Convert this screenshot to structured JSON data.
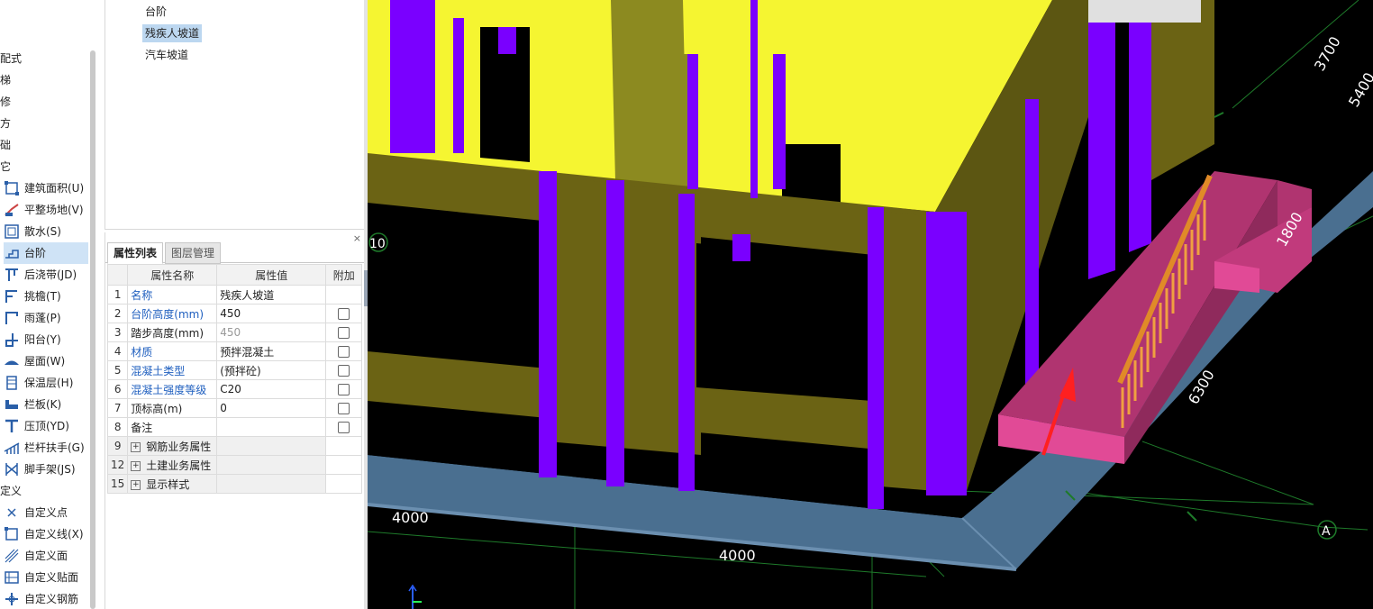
{
  "nav": {
    "groups": [
      {
        "label": "配式"
      },
      {
        "label": "梯"
      },
      {
        "label": "修"
      },
      {
        "label": "方"
      },
      {
        "label": "础"
      },
      {
        "label": "它"
      }
    ],
    "items": [
      {
        "label": "建筑面积(U)",
        "icon": "area-icon"
      },
      {
        "label": "平整场地(V)",
        "icon": "level-site-icon"
      },
      {
        "label": "散水(S)",
        "icon": "apron-icon"
      },
      {
        "label": "台阶",
        "icon": "step-icon"
      },
      {
        "label": "后浇带(JD)",
        "icon": "post-pour-strip-icon"
      },
      {
        "label": "挑檐(T)",
        "icon": "eave-icon"
      },
      {
        "label": "雨蓬(P)",
        "icon": "canopy-icon"
      },
      {
        "label": "阳台(Y)",
        "icon": "balcony-icon"
      },
      {
        "label": "屋面(W)",
        "icon": "roof-icon"
      },
      {
        "label": "保温层(H)",
        "icon": "insulation-icon"
      },
      {
        "label": "栏板(K)",
        "icon": "parapet-icon"
      },
      {
        "label": "压顶(YD)",
        "icon": "coping-icon"
      },
      {
        "label": "栏杆扶手(G)",
        "icon": "railing-icon"
      },
      {
        "label": "脚手架(JS)",
        "icon": "scaffold-icon"
      }
    ],
    "group2": {
      "label": "定义"
    },
    "items2": [
      {
        "label": "自定义点",
        "icon": "custom-point-icon"
      },
      {
        "label": "自定义线(X)",
        "icon": "custom-line-icon"
      },
      {
        "label": "自定义面",
        "icon": "custom-face-icon"
      },
      {
        "label": "自定义贴面",
        "icon": "custom-veneer-icon"
      },
      {
        "label": "自定义钢筋",
        "icon": "custom-rebar-icon"
      }
    ]
  },
  "typelist": {
    "items": [
      {
        "label": "台阶"
      },
      {
        "label": "残疾人坡道"
      },
      {
        "label": "汽车坡道"
      }
    ]
  },
  "props": {
    "close": "×",
    "tabs": [
      {
        "label": "属性列表"
      },
      {
        "label": "图层管理"
      }
    ],
    "headers": {
      "name": "属性名称",
      "value": "属性值",
      "extra": "附加"
    },
    "rows": [
      {
        "num": "1",
        "name": "名称",
        "value": "残疾人坡道"
      },
      {
        "num": "2",
        "name": "台阶高度(mm)",
        "value": "450"
      },
      {
        "num": "3",
        "name": "踏步高度(mm)",
        "value": "450"
      },
      {
        "num": "4",
        "name": "材质",
        "value": "预拌混凝土"
      },
      {
        "num": "5",
        "name": "混凝土类型",
        "value": "(预拌砼)"
      },
      {
        "num": "6",
        "name": "混凝土强度等级",
        "value": "C20"
      },
      {
        "num": "7",
        "name": "顶标高(m)",
        "value": "0"
      },
      {
        "num": "8",
        "name": "备注",
        "value": ""
      },
      {
        "num": "9",
        "name": "钢筋业务属性",
        "value": ""
      },
      {
        "num": "12",
        "name": "土建业务属性",
        "value": ""
      },
      {
        "num": "15",
        "name": "显示样式",
        "value": ""
      }
    ]
  },
  "viewport": {
    "dims": {
      "d3700": "3700",
      "d5400": "5400",
      "d1800": "1800",
      "d6300": "6300",
      "d4000a": "4000",
      "d4000b": "4000"
    },
    "axis_a": "A",
    "axis_10": "10",
    "colors": {
      "wall": "#f5f531",
      "column": "#7a00ff",
      "beam": "#6b6314",
      "apron": "#4a6f90",
      "ramp": "#c13a7c",
      "railing": "#e08a28",
      "grid": "#1e7a2a"
    }
  }
}
